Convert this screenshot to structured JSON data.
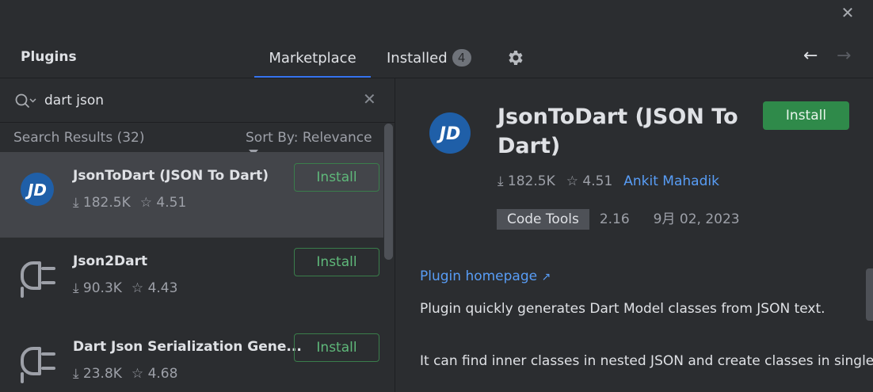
{
  "window": {
    "close_glyph": "✕"
  },
  "header": {
    "title": "Plugins",
    "tabs": {
      "marketplace": "Marketplace",
      "installed": "Installed",
      "installed_count": "4"
    },
    "settings_icon": "gear-icon",
    "back_glyph": "←",
    "forward_glyph": "→"
  },
  "search": {
    "value": "dart json",
    "clear_glyph": "✕"
  },
  "results": {
    "count_label": "Search Results (32)",
    "sort_label": "Sort By: Relevance",
    "items": [
      {
        "name": "JsonToDart (JSON To Dart)",
        "downloads": "182.5K",
        "rating": "4.51",
        "install_label": "Install",
        "icon": "jd-logo"
      },
      {
        "name": "Json2Dart",
        "downloads": "90.3K",
        "rating": "4.43",
        "install_label": "Install",
        "icon": "plugin-plug-icon"
      },
      {
        "name": "Dart Json Serialization Gene...",
        "downloads": "23.8K",
        "rating": "4.68",
        "install_label": "Install",
        "icon": "plugin-plug-icon"
      }
    ]
  },
  "detail": {
    "name": "JsonToDart (JSON To Dart)",
    "install_label": "Install",
    "downloads": "182.5K",
    "rating": "4.51",
    "author": "Ankit Mahadik",
    "tag": "Code Tools",
    "version": "2.16",
    "date": "9月 02, 2023",
    "homepage_label": "Plugin homepage",
    "homepage_arrow": "↗",
    "description": [
      "Plugin quickly generates Dart Model classes from JSON text.",
      "It can find inner classes in nested JSON and create classes in single"
    ]
  },
  "glyphs": {
    "download": "⤓",
    "star": "☆"
  },
  "colors": {
    "accent": "#3574f0",
    "install_green": "#2f8a4a",
    "link": "#589df6",
    "jd_logo_bg": "#1f5fa8"
  }
}
